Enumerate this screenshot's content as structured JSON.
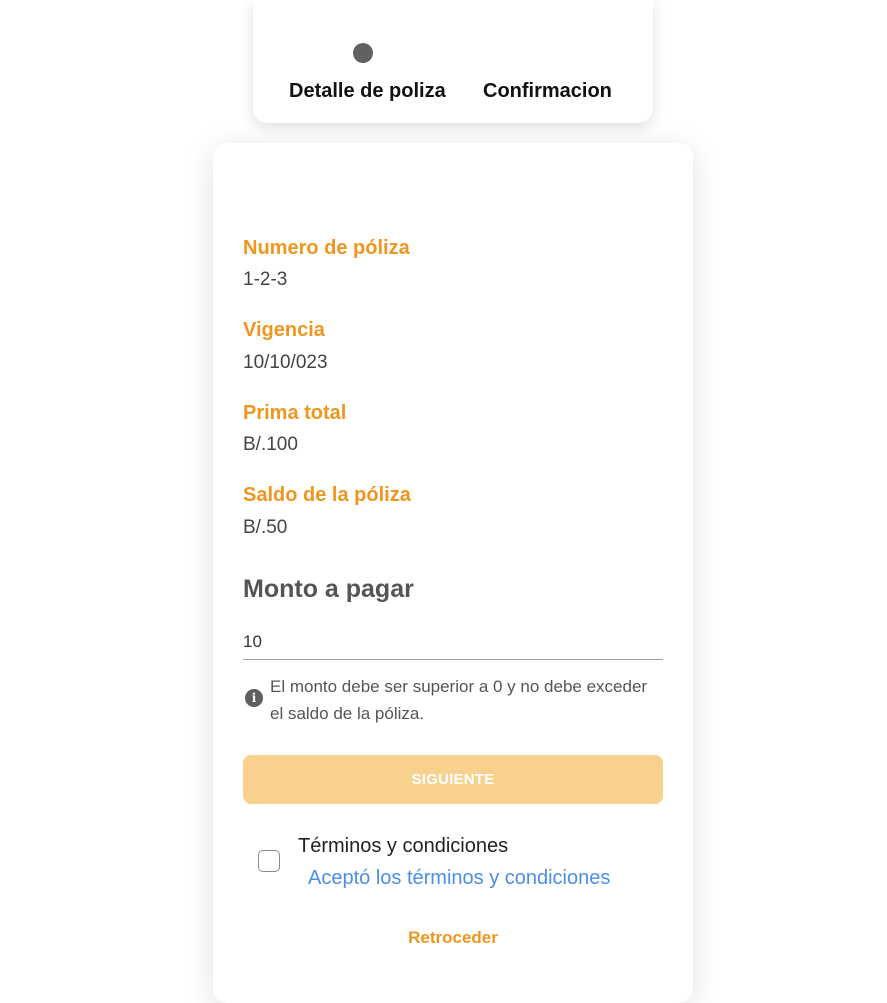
{
  "stepper": {
    "steps": [
      {
        "label": "Detalle de poliza"
      },
      {
        "label": "Confirmacion"
      }
    ]
  },
  "policy": {
    "fields": [
      {
        "label": "Numero de póliza",
        "value": "1-2-3"
      },
      {
        "label": "Vigencia",
        "value": "10/10/023"
      },
      {
        "label": "Prima total",
        "value": "B/.100"
      },
      {
        "label": "Saldo de la póliza",
        "value": "B/.50"
      }
    ]
  },
  "payment": {
    "title": "Monto a pagar",
    "amount_value": "10",
    "hint": "El monto debe ser superior a 0 y no debe exceder el saldo de la póliza.",
    "next_label": "SIGUIENTE"
  },
  "terms": {
    "title": "Términos y condiciones",
    "link_label": "Aceptó los términos y condiciones",
    "checked": false
  },
  "back_label": "Retroceder",
  "colors": {
    "accent": "#f0961e",
    "button_disabled": "#f8d18e",
    "link": "#4a8fe7"
  },
  "icons": {
    "step_indicator": "filled-circle-icon",
    "hint": "info-icon"
  }
}
